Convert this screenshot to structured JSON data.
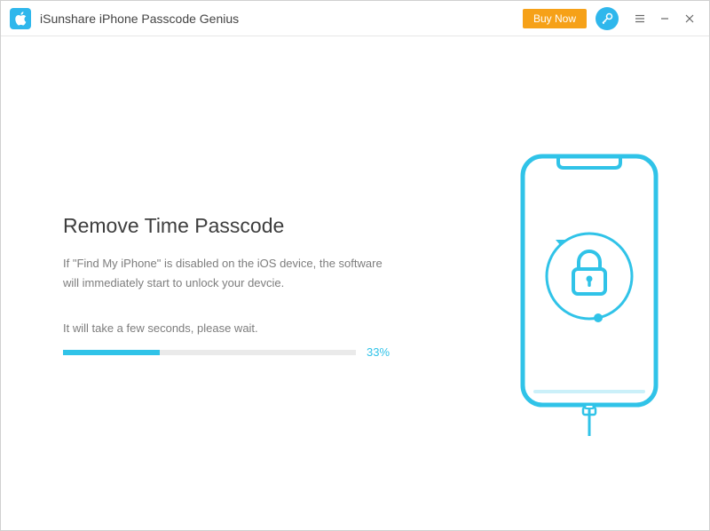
{
  "titlebar": {
    "app_title": "iSunshare iPhone Passcode Genius",
    "buy_now_label": "Buy Now"
  },
  "main": {
    "heading": "Remove Time Passcode",
    "description": "If \"Find My iPhone\" is disabled on the iOS device, the software will immediately start to unlock your devcie.",
    "wait_text": "It will take a few seconds, please wait.",
    "progress_percent": 33,
    "progress_label": "33%"
  },
  "colors": {
    "accent": "#30c3e8",
    "buy_now_bg": "#f6a118"
  }
}
